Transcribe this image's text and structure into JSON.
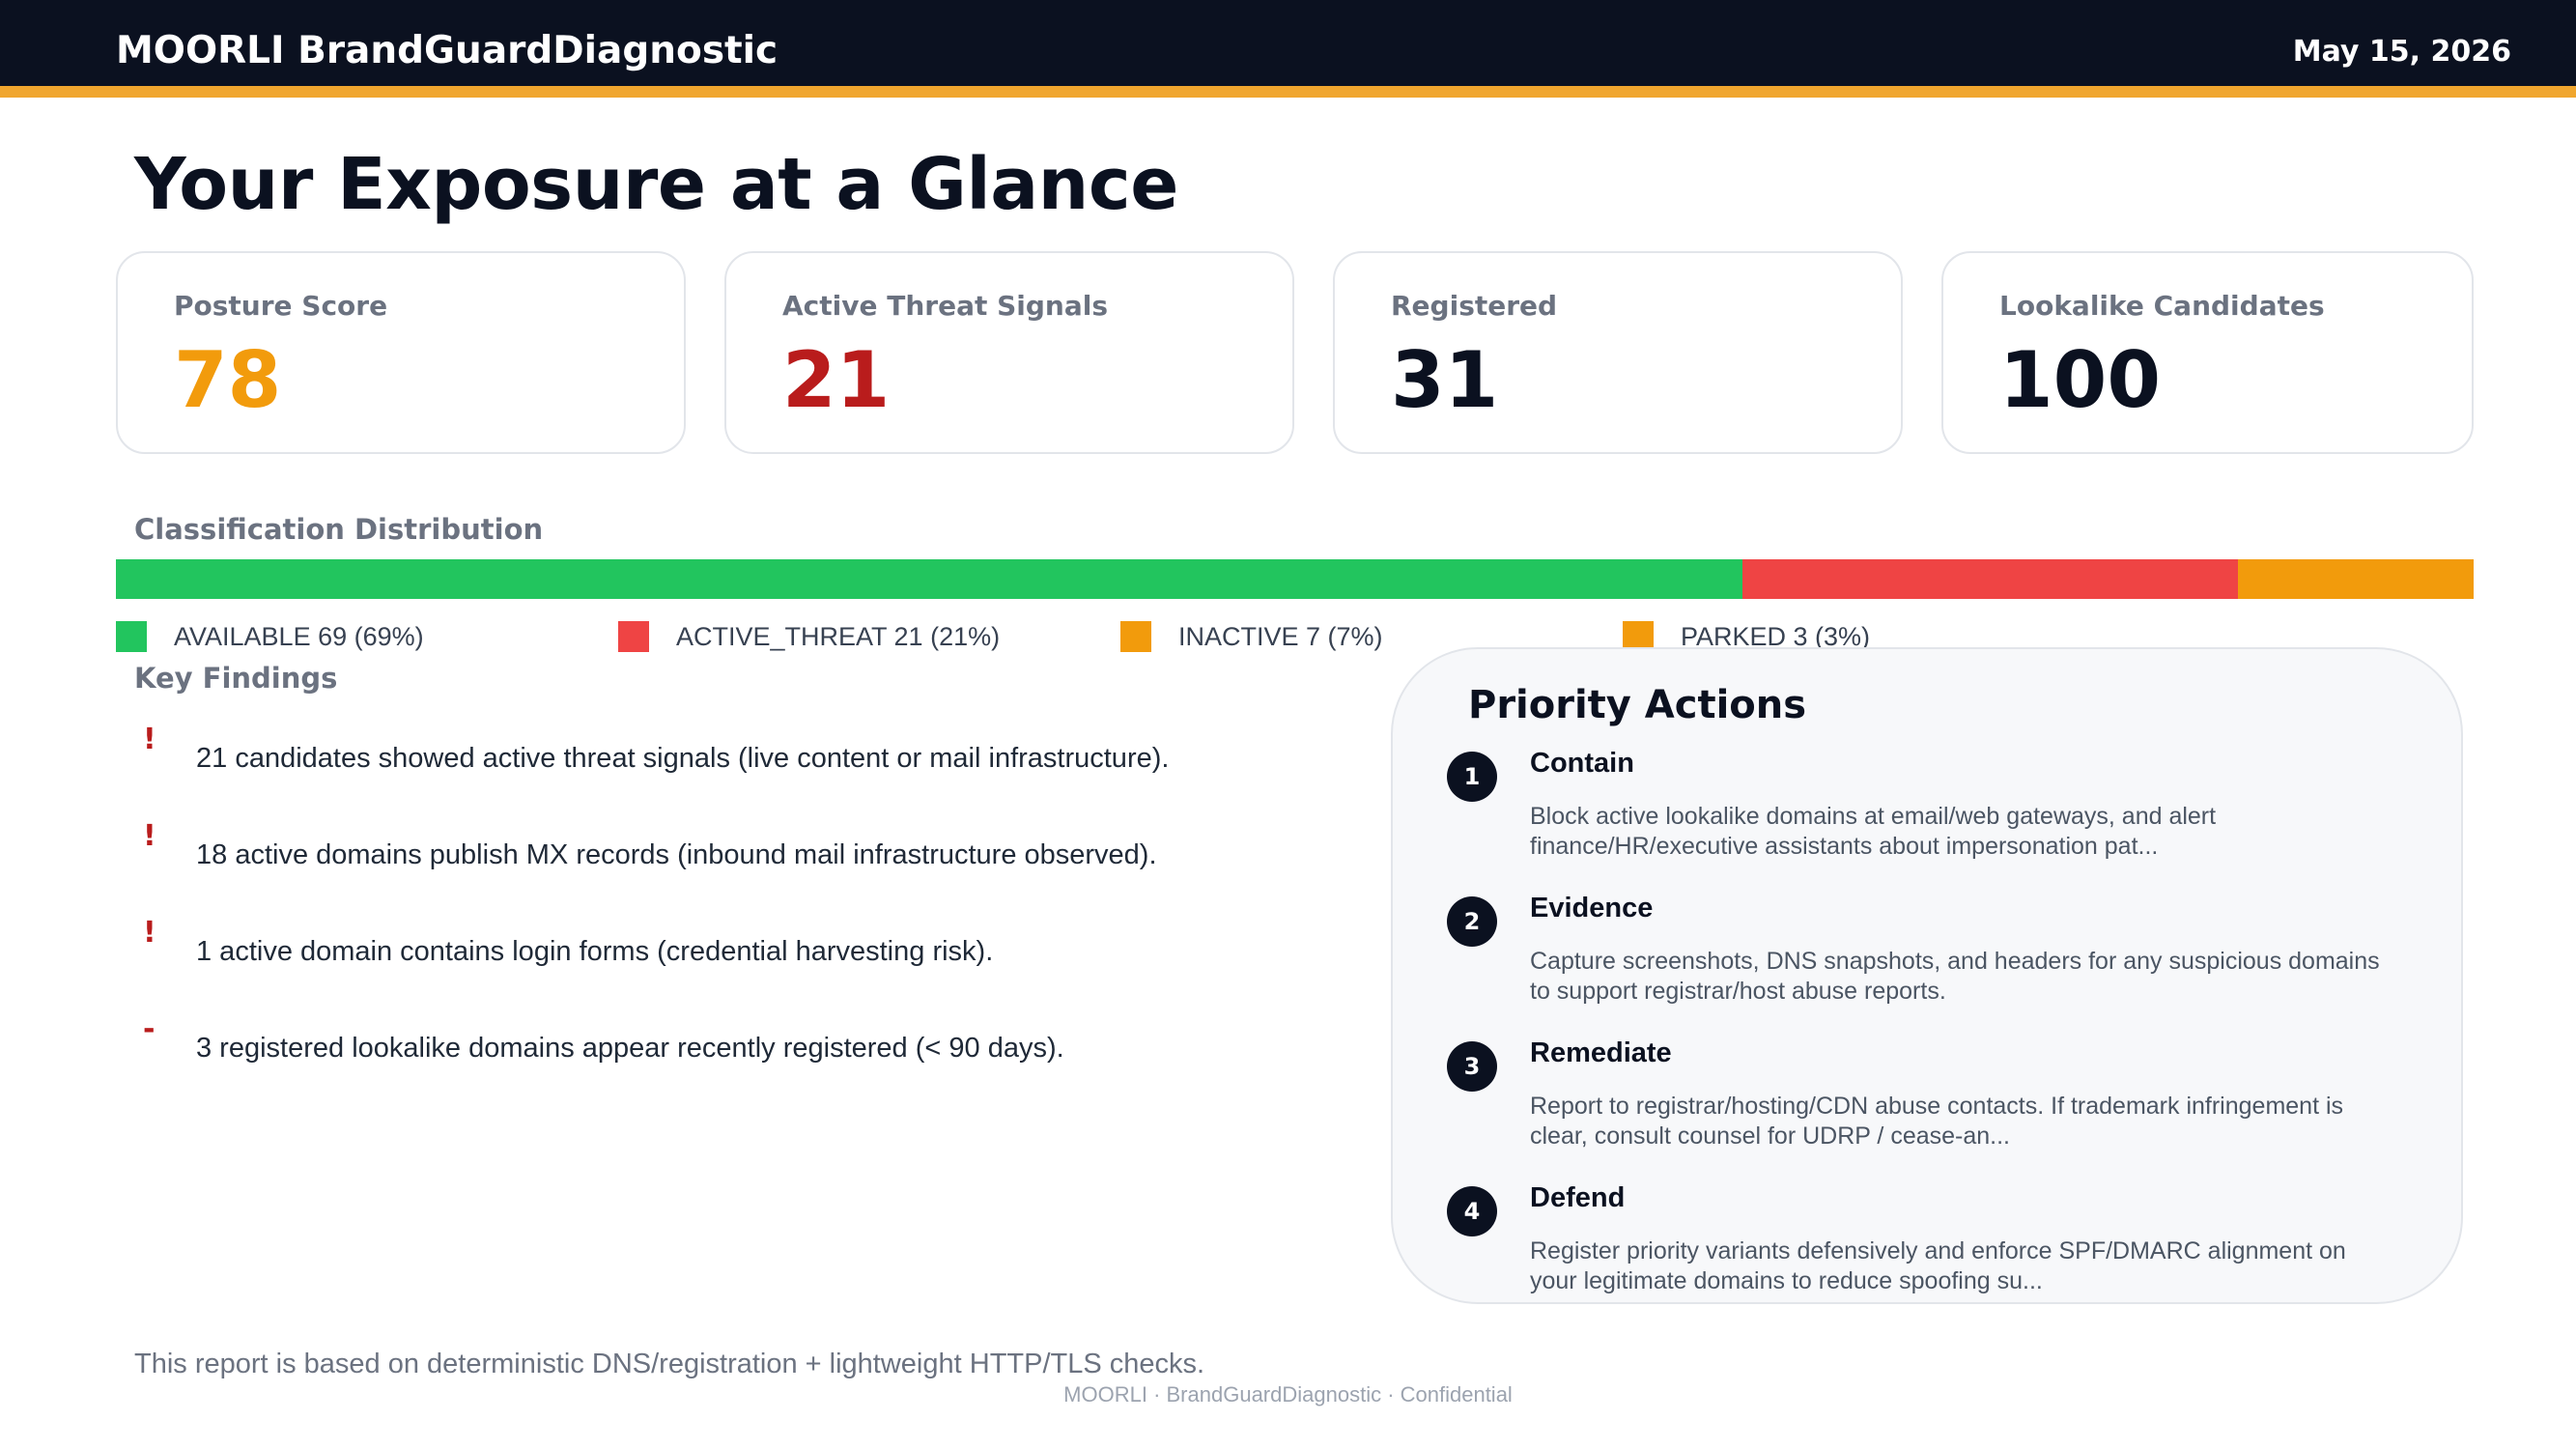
{
  "header": {
    "brand": "MOORLI BrandGuardDiagnostic",
    "date": "May 15, 2026",
    "accent_color": "#f0a62e"
  },
  "page_title": "Your Exposure at a Glance",
  "cards": [
    {
      "label": "Posture Score",
      "value": "78",
      "color": "#f29b0c"
    },
    {
      "label": "Active Threat Signals",
      "value": "21",
      "color": "#b91c1c"
    },
    {
      "label": "Registered",
      "value": "31",
      "color": "#0b1120"
    },
    {
      "label": "Lookalike Candidates",
      "value": "100",
      "color": "#0b1120"
    }
  ],
  "distribution": {
    "label": "Classification Distribution",
    "segments": [
      {
        "label": "AVAILABLE 69 (69%)",
        "percent": 69,
        "color": "#22c55e"
      },
      {
        "label": "ACTIVE_THREAT 21 (21%)",
        "percent": 21,
        "color": "#ef4444"
      },
      {
        "label": "INACTIVE 7 (7%)",
        "percent": 7,
        "color": "#f29b0c"
      },
      {
        "label": "PARKED 3 (3%)",
        "percent": 3,
        "color": "#f29b0c"
      }
    ]
  },
  "findings": {
    "label": "Key Findings",
    "items": [
      {
        "mark": "!",
        "text": "21 candidates showed active threat signals (live content or mail infrastructure)."
      },
      {
        "mark": "!",
        "text": "18 active domains publish MX records (inbound mail infrastructure observed)."
      },
      {
        "mark": "!",
        "text": "1 active domain contains login forms (credential harvesting risk)."
      },
      {
        "mark": "-",
        "text": "3 registered lookalike domains appear recently registered (< 90 days)."
      }
    ]
  },
  "priority_actions": {
    "title": "Priority Actions",
    "items": [
      {
        "num": "1",
        "title": "Contain",
        "desc": "Block active lookalike domains at email/web gateways, and alert finance/HR/executive assistants about impersonation pat..."
      },
      {
        "num": "2",
        "title": "Evidence",
        "desc": "Capture screenshots, DNS snapshots, and headers for any suspicious domains to support registrar/host abuse reports."
      },
      {
        "num": "3",
        "title": "Remediate",
        "desc": "Report to registrar/hosting/CDN abuse contacts. If trademark infringement is clear, consult counsel for UDRP / cease-an..."
      },
      {
        "num": "4",
        "title": "Defend",
        "desc": "Register priority variants defensively and enforce SPF/DMARC alignment on your legitimate domains to reduce spoofing su..."
      }
    ]
  },
  "footer": {
    "note": "This report is based on deterministic DNS/registration + lightweight HTTP/TLS checks.",
    "confidential": "MOORLI · BrandGuardDiagnostic · Confidential"
  }
}
